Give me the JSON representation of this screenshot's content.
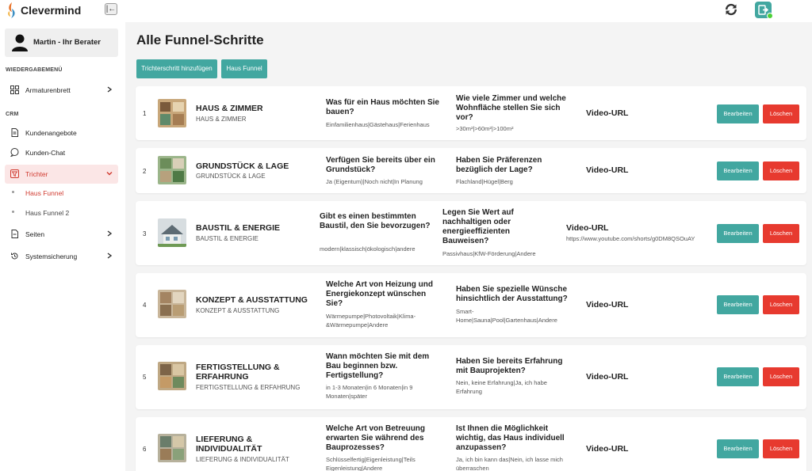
{
  "app": {
    "brand": "Clevermind",
    "collapse_glyph": "|←"
  },
  "colors": {
    "accent": "#42a7a0",
    "danger": "#e73a2f",
    "active_bg": "#fbe6e6",
    "active_text": "#d03a2f"
  },
  "sidebar": {
    "user_name": "Martin - Ihr Berater",
    "section_1": "WIEDERGABEMENÜ",
    "section_2": "CRM",
    "items": [
      {
        "label": "Armaturenbrett",
        "icon": "dashboard-icon"
      },
      {
        "label": "Kundenangebote",
        "icon": "document-icon"
      },
      {
        "label": "Kunden-Chat",
        "icon": "chat-icon"
      },
      {
        "label": "Trichter",
        "icon": "funnel-icon"
      },
      {
        "label": "Seiten",
        "icon": "page-icon"
      },
      {
        "label": "Systemsicherung",
        "icon": "backup-icon"
      }
    ],
    "sub_items": [
      {
        "label": "Haus Funnel"
      },
      {
        "label": "Haus Funnel 2"
      }
    ]
  },
  "main": {
    "title": "Alle Funnel-Schritte",
    "add_step_label": "Trichterschritt hinzufügen",
    "funnel_label": "Haus Funnel",
    "edit_label": "Bearbeiten",
    "delete_label": "Löschen",
    "rows": [
      {
        "num": "1",
        "name": "HAUS & ZIMMER",
        "sub": "HAUS & ZIMMER",
        "q1": "Was für ein Haus möchten Sie bauen?",
        "a1": "Einfamilienhaus|Gästehaus|Ferienhaus",
        "q2": "Wie viele Zimmer und welche Wohnfläche stellen Sie sich vor?",
        "a2": ">30m²|>60m²|>100m²",
        "video": "Video-URL",
        "video_url": ""
      },
      {
        "num": "2",
        "name": "GRUNDSTÜCK & LAGE",
        "sub": "GRUNDSTÜCK & LAGE",
        "q1": "Verfügen Sie bereits über ein Grundstück?",
        "a1": "Ja (Eigentum)|Noch nicht|In Planung",
        "q2": "Haben Sie Präferenzen bezüglich der Lage?",
        "a2": "Flachland|Hügel|Berg",
        "video": "Video-URL",
        "video_url": ""
      },
      {
        "num": "3",
        "name": "BAUSTIL & ENERGIE",
        "sub": "BAUSTIL & ENERGIE",
        "q1": "Gibt es einen bestimmten Baustil, den Sie bevorzugen?",
        "a1": "modern|klassisch|ökologisch|andere",
        "q2": "Legen Sie Wert auf nachhaltigen oder energieeffizienten Bauweisen?",
        "a2": "Passivhaus|KfW-Förderung|Andere",
        "video": "Video-URL",
        "video_url": "https://www.youtube.com/shorts/g0DM8QSOuAY"
      },
      {
        "num": "4",
        "name": "KONZEPT & AUSSTATTUNG",
        "sub": "KONZEPT & AUSSTATTUNG",
        "q1": "Welche Art von Heizung und Energiekonzept wünschen Sie?",
        "a1": "Wärmepumpe|Photovoltaik|Klima-&Wärmepumpe|Andere",
        "q2": "Haben Sie spezielle Wünsche hinsichtlich der Ausstattung?",
        "a2": "Smart-Home|Sauna|Pool|Gartenhaus|Andere",
        "video": "Video-URL",
        "video_url": ""
      },
      {
        "num": "5",
        "name": "FERTIGSTELLUNG & ERFAHRUNG",
        "sub": "FERTIGSTELLUNG & ERFAHRUNG",
        "q1": "Wann möchten Sie mit dem Bau beginnen bzw. Fertigstellung?",
        "a1": "in 1-3 Monaten|in 6 Monaten|in 9 Monaten|später",
        "q2": "Haben Sie bereits Erfahrung mit Bauprojekten?",
        "a2": "Nein, keine Erfahrung|Ja, ich habe Erfahrung",
        "video": "Video-URL",
        "video_url": ""
      },
      {
        "num": "6",
        "name": "LIEFERUNG & INDIVIDUALITÄT",
        "sub": "LIEFERUNG & INDIVIDUALITÄT",
        "q1": "Welche Art von Betreuung erwarten Sie während des Bauprozesses?",
        "a1": "Schlüsselfertig|Eigenleistung|Teils Eigenleistung|Andere",
        "q2": "Ist Ihnen die Möglichkeit wichtig, das Haus individuell anzupassen?",
        "a2": "Ja, ich bin kann das|Nein, ich lasse mich überraschen",
        "video": "Video-URL",
        "video_url": ""
      }
    ]
  }
}
